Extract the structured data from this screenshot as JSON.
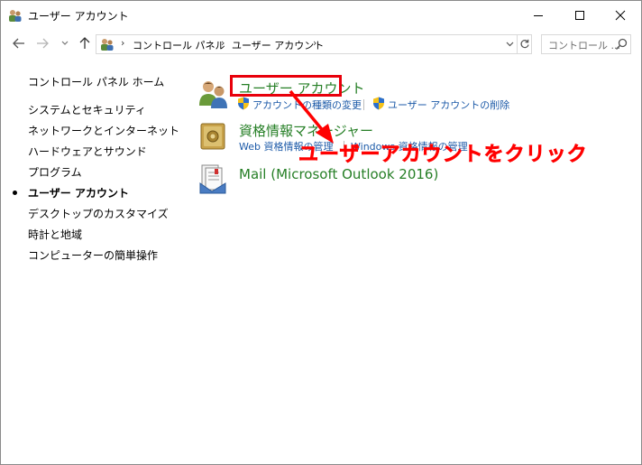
{
  "window": {
    "title": "ユーザー アカウント"
  },
  "address_bar": {
    "breadcrumbs": [
      "コントロール パネル",
      "ユーザー アカウント"
    ],
    "search_placeholder": "コントロール ..."
  },
  "sidebar": {
    "items": [
      {
        "label": "コントロール パネル ホーム",
        "current": false
      },
      {
        "label": "システムとセキュリティ",
        "current": false
      },
      {
        "label": "ネットワークとインターネット",
        "current": false
      },
      {
        "label": "ハードウェアとサウンド",
        "current": false
      },
      {
        "label": "プログラム",
        "current": false
      },
      {
        "label": "ユーザー アカウント",
        "current": true
      },
      {
        "label": "デスクトップのカスタマイズ",
        "current": false
      },
      {
        "label": "時計と地域",
        "current": false
      },
      {
        "label": "コンピューターの簡単操作",
        "current": false
      }
    ]
  },
  "main": {
    "categories": [
      {
        "title": "ユーザー アカウント",
        "icon": "users-icon",
        "links": [
          "アカウントの種類の変更",
          "ユーザー アカウントの削除"
        ]
      },
      {
        "title": "資格情報マネージャー",
        "icon": "credential-vault-icon",
        "links": [
          "Web 資格情報の管理",
          "Windows 資格情報の管理"
        ]
      },
      {
        "title": "Mail (Microsoft Outlook 2016)",
        "icon": "mail-icon",
        "links": []
      }
    ]
  },
  "annotation": {
    "text": "ユーザーアカウントをクリック",
    "color": "#ff0000"
  },
  "colors": {
    "category_title": "#267f26",
    "link": "#1c5aa8",
    "highlight": "#e8000b"
  }
}
